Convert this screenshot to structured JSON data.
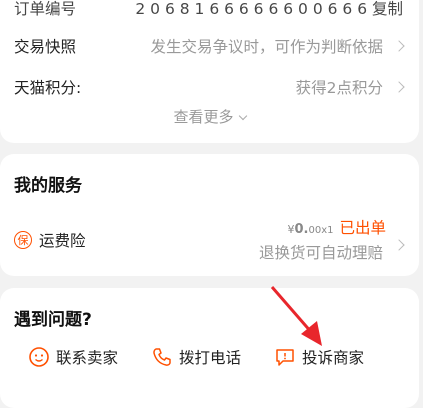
{
  "order_info": {
    "top_row_label": "订单编号",
    "top_row_value": "2 0 6 8 1 6 6 6 6 6 6 0 0 6 6 6  复制",
    "rows": [
      {
        "label": "交易快照",
        "value": "发生交易争议时，可作为判断依据"
      },
      {
        "label": "天猫积分:",
        "value": "获得2点积分"
      }
    ],
    "more_label": "查看更多"
  },
  "services": {
    "title": "我的服务",
    "item_label": "运费险",
    "badge_icon_text": "保",
    "price_symbol": "¥",
    "price_int": "0.",
    "price_rest": "00x1",
    "status": "已出单",
    "desc": "退换货可自动理赔"
  },
  "help": {
    "title": "遇到问题?",
    "actions": [
      {
        "label": "联系卖家",
        "icon": "chat-smile-icon"
      },
      {
        "label": "拨打电话",
        "icon": "phone-icon"
      },
      {
        "label": "投诉商家",
        "icon": "complaint-icon"
      }
    ]
  },
  "colors": {
    "accent": "#ff5000",
    "annotation_arrow": "#e8262c"
  }
}
